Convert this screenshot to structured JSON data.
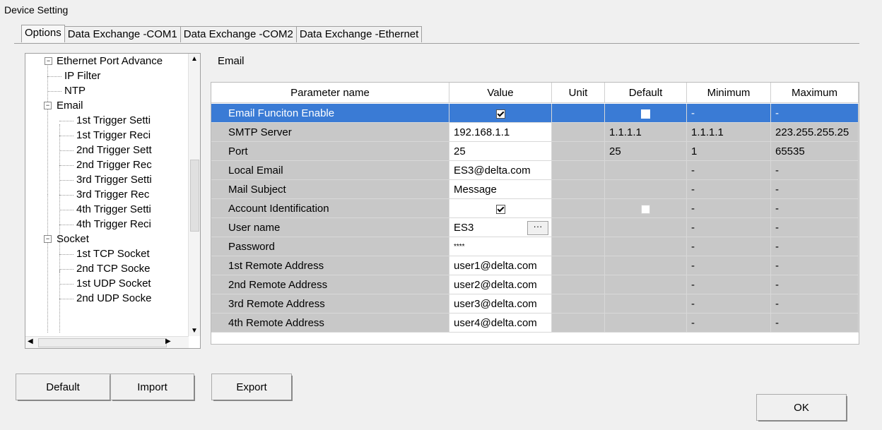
{
  "window": {
    "title": "Device Setting"
  },
  "tabs": [
    {
      "label": "Options"
    },
    {
      "label": "Data Exchange -COM1"
    },
    {
      "label": "Data Exchange -COM2"
    },
    {
      "label": "Data Exchange -Ethernet"
    }
  ],
  "tree": {
    "items": [
      {
        "label": "Ethernet Port Advance"
      },
      {
        "label": "IP Filter"
      },
      {
        "label": "NTP"
      },
      {
        "label": "Email"
      },
      {
        "label": "1st Trigger Setti"
      },
      {
        "label": "1st Trigger Reci"
      },
      {
        "label": "2nd Trigger Sett"
      },
      {
        "label": "2nd Trigger Rec"
      },
      {
        "label": "3rd Trigger Setti"
      },
      {
        "label": "3rd Trigger Rec"
      },
      {
        "label": "4th Trigger Setti"
      },
      {
        "label": "4th Trigger Reci"
      },
      {
        "label": "Socket"
      },
      {
        "label": "1st TCP Socket"
      },
      {
        "label": "2nd TCP Socke"
      },
      {
        "label": "1st UDP Socket"
      },
      {
        "label": "2nd UDP Socke"
      }
    ]
  },
  "section_title": "Email",
  "grid": {
    "headers": [
      "Parameter name",
      "Value",
      "Unit",
      "Default",
      "Minimum",
      "Maximum"
    ],
    "rows": [
      {
        "name": "Email Funciton Enable",
        "value": "",
        "unit": "",
        "default": "",
        "min": "-",
        "max": "-"
      },
      {
        "name": "SMTP Server",
        "value": "192.168.1.1",
        "unit": "",
        "default": "1.1.1.1",
        "min": "1.1.1.1",
        "max": "223.255.255.25"
      },
      {
        "name": "Port",
        "value": "25",
        "unit": "",
        "default": "25",
        "min": "1",
        "max": "65535"
      },
      {
        "name": "Local Email",
        "value": "ES3@delta.com",
        "unit": "",
        "default": "",
        "min": "-",
        "max": "-"
      },
      {
        "name": "Mail Subject",
        "value": "Message",
        "unit": "",
        "default": "",
        "min": "-",
        "max": "-"
      },
      {
        "name": "Account Identification",
        "value": "",
        "unit": "",
        "default": "",
        "min": "-",
        "max": "-"
      },
      {
        "name": "User name",
        "value": "ES3",
        "unit": "",
        "default": "",
        "min": "-",
        "max": "-"
      },
      {
        "name": "Password",
        "value": "****",
        "unit": "",
        "default": "",
        "min": "-",
        "max": "-"
      },
      {
        "name": "1st Remote Address",
        "value": "user1@delta.com",
        "unit": "",
        "default": "",
        "min": "-",
        "max": "-"
      },
      {
        "name": "2nd Remote Address",
        "value": "user2@delta.com",
        "unit": "",
        "default": "",
        "min": "-",
        "max": "-"
      },
      {
        "name": "3rd Remote Address",
        "value": "user3@delta.com",
        "unit": "",
        "default": "",
        "min": "-",
        "max": "-"
      },
      {
        "name": "4th Remote Address",
        "value": "user4@delta.com",
        "unit": "",
        "default": "",
        "min": "-",
        "max": "-"
      }
    ],
    "ellipsis": "···"
  },
  "buttons": {
    "default": "Default",
    "import": "Import",
    "export": "Export",
    "ok": "OK"
  },
  "colors": {
    "selection": "#3a7bd5",
    "readonly_cell": "#c8c8c8"
  }
}
